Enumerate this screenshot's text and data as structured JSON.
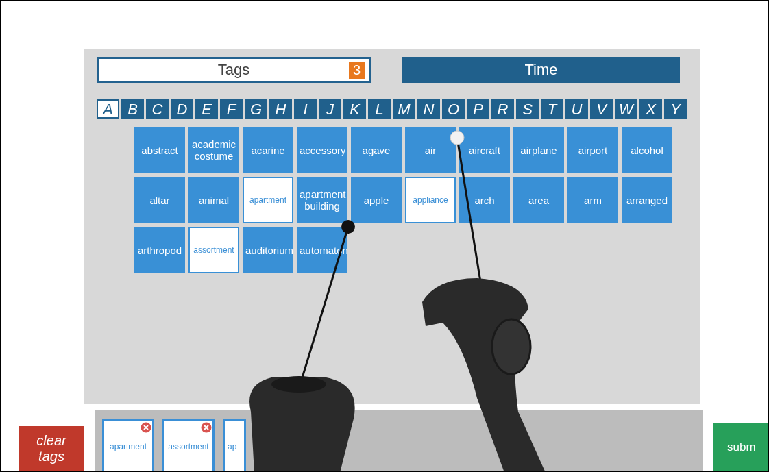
{
  "tags_field": {
    "label": "Tags",
    "count": "3"
  },
  "time_button": {
    "label": "Time"
  },
  "letters": [
    {
      "label": "A",
      "selected": true
    },
    {
      "label": "B",
      "selected": false
    },
    {
      "label": "C",
      "selected": false
    },
    {
      "label": "D",
      "selected": false
    },
    {
      "label": "E",
      "selected": false
    },
    {
      "label": "F",
      "selected": false
    },
    {
      "label": "G",
      "selected": false
    },
    {
      "label": "H",
      "selected": false
    },
    {
      "label": "I",
      "selected": false
    },
    {
      "label": "J",
      "selected": false
    },
    {
      "label": "K",
      "selected": false
    },
    {
      "label": "L",
      "selected": false
    },
    {
      "label": "M",
      "selected": false
    },
    {
      "label": "N",
      "selected": false
    },
    {
      "label": "O",
      "selected": false
    },
    {
      "label": "P",
      "selected": false
    },
    {
      "label": "R",
      "selected": false
    },
    {
      "label": "S",
      "selected": false
    },
    {
      "label": "T",
      "selected": false
    },
    {
      "label": "U",
      "selected": false
    },
    {
      "label": "V",
      "selected": false
    },
    {
      "label": "W",
      "selected": false
    },
    {
      "label": "X",
      "selected": false
    },
    {
      "label": "Y",
      "selected": false
    }
  ],
  "tiles": [
    {
      "label": "abstract",
      "selected": false
    },
    {
      "label": "academic costume",
      "selected": false
    },
    {
      "label": "acarine",
      "selected": false
    },
    {
      "label": "accessory",
      "selected": false
    },
    {
      "label": "agave",
      "selected": false
    },
    {
      "label": "air",
      "selected": false
    },
    {
      "label": "aircraft",
      "selected": false
    },
    {
      "label": "airplane",
      "selected": false
    },
    {
      "label": "airport",
      "selected": false
    },
    {
      "label": "alcohol",
      "selected": false
    },
    {
      "label": "altar",
      "selected": false
    },
    {
      "label": "animal",
      "selected": false
    },
    {
      "label": "apartment",
      "selected": true
    },
    {
      "label": "apartment building",
      "selected": false
    },
    {
      "label": "apple",
      "selected": false
    },
    {
      "label": "appliance",
      "selected": true
    },
    {
      "label": "arch",
      "selected": false
    },
    {
      "label": "area",
      "selected": false
    },
    {
      "label": "arm",
      "selected": false
    },
    {
      "label": "arranged",
      "selected": false
    },
    {
      "label": "arthropod",
      "selected": false
    },
    {
      "label": "assortment",
      "selected": true
    },
    {
      "label": "auditorium",
      "selected": false
    },
    {
      "label": "automaton",
      "selected": false
    }
  ],
  "clear_button": {
    "label": "clear tags"
  },
  "selected_tags": [
    {
      "label": "apartment"
    },
    {
      "label": "assortment"
    },
    {
      "label": "ap"
    }
  ],
  "submit_button": {
    "label": "subm"
  }
}
